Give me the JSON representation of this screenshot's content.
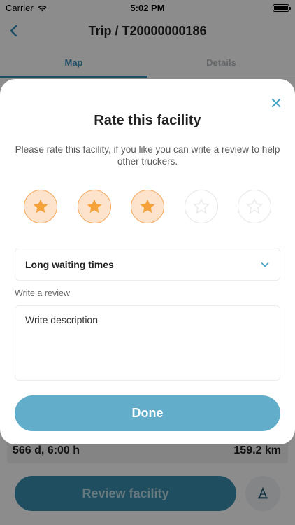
{
  "status_bar": {
    "carrier": "Carrier",
    "time": "5:02 PM"
  },
  "nav": {
    "title": "Trip / T20000000186"
  },
  "tabs": [
    {
      "label": "Map",
      "active": true
    },
    {
      "label": "Details",
      "active": false
    }
  ],
  "trip_info": {
    "duration": "566 d, 6:00 h",
    "distance": "159.2 km"
  },
  "bottom": {
    "review_button": "Review facility"
  },
  "modal": {
    "title": "Rate this facility",
    "description": "Please rate this facility, if you like you can write a review to help other truckers.",
    "rating": {
      "value": 3,
      "max": 5
    },
    "reason": {
      "selected": "Long waiting times"
    },
    "review_label": "Write a review",
    "review_placeholder": "Write description",
    "done_label": "Done"
  },
  "colors": {
    "accent": "#3a8fb5",
    "star_fill": "#f6a23b",
    "done_button": "#62adc9"
  }
}
